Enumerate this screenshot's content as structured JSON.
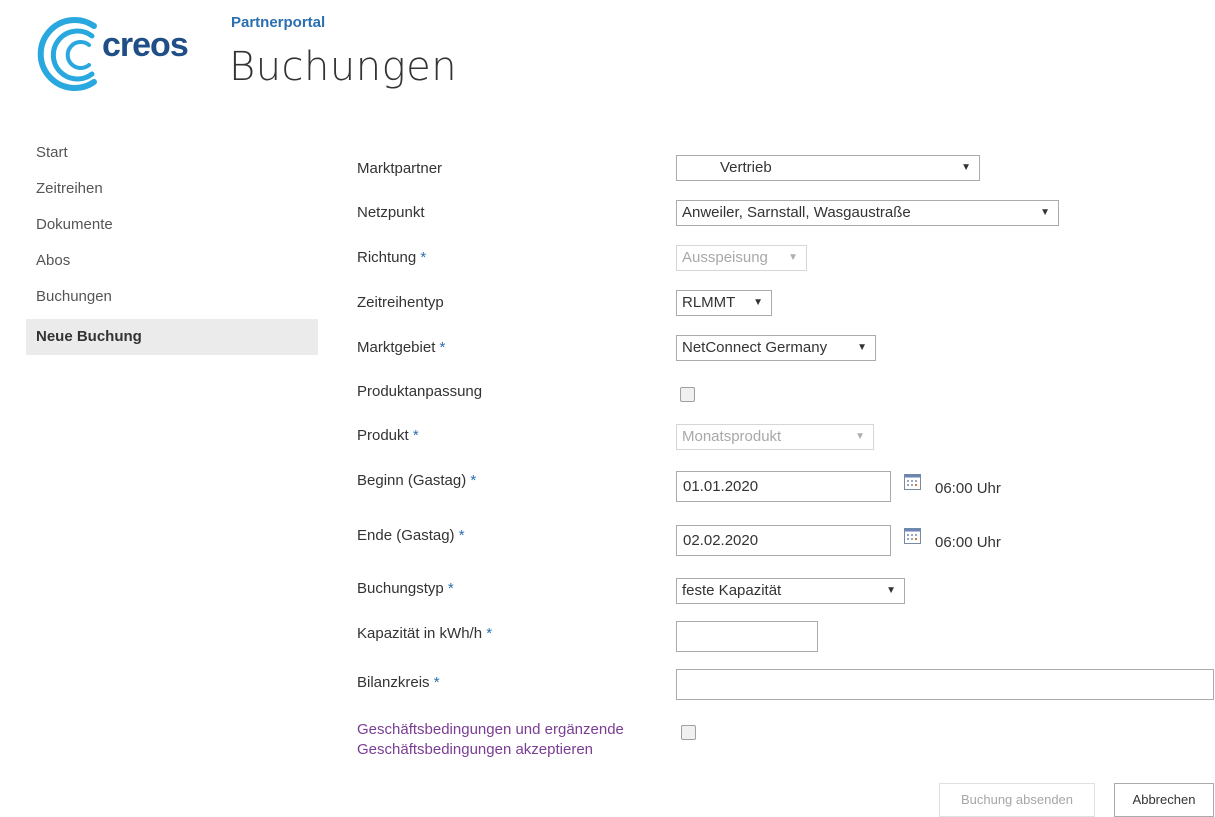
{
  "header": {
    "logo_text": "creos",
    "site_title": "Partnerportal",
    "page_title": "Buchungen"
  },
  "nav": {
    "items": [
      {
        "label": "Start",
        "active": false
      },
      {
        "label": "Zeitreihen",
        "active": false
      },
      {
        "label": "Dokumente",
        "active": false
      },
      {
        "label": "Abos",
        "active": false
      },
      {
        "label": "Buchungen",
        "active": false
      },
      {
        "label": "Neue Buchung",
        "active": true
      }
    ]
  },
  "form": {
    "required_marker": "*",
    "marktpartner": {
      "label": "Marktpartner",
      "value": "Vertrieb"
    },
    "netzpunkt": {
      "label": "Netzpunkt",
      "value": "Anweiler, Sarnstall, Wasgaustraße"
    },
    "richtung": {
      "label": "Richtung",
      "value": "Ausspeisung"
    },
    "zeitreihentyp": {
      "label": "Zeitreihentyp",
      "value": "RLMMT"
    },
    "marktgebiet": {
      "label": "Marktgebiet",
      "value": "NetConnect Germany"
    },
    "produktanpassung": {
      "label": "Produktanpassung",
      "checked": false
    },
    "produkt": {
      "label": "Produkt",
      "value": "Monatsprodukt"
    },
    "beginn": {
      "label": "Beginn (Gastag)",
      "value": "01.01.2020",
      "time": "06:00 Uhr"
    },
    "ende": {
      "label": "Ende (Gastag)",
      "value": "02.02.2020",
      "time": "06:00 Uhr"
    },
    "buchungstyp": {
      "label": "Buchungstyp",
      "value": "feste Kapazität"
    },
    "kapazitaet": {
      "label": "Kapazität in kWh/h",
      "value": ""
    },
    "bilanzkreis": {
      "label": "Bilanzkreis",
      "value": ""
    },
    "terms": {
      "line1": "Geschäftsbedingungen und ergänzende",
      "line2": "Geschäftsbedingungen akzeptieren",
      "checked": false
    }
  },
  "buttons": {
    "submit": "Buchung absenden",
    "cancel": "Abbrechen"
  },
  "colors": {
    "accent": "#2b6fb0",
    "link": "#7a3d94",
    "logo_ring": "#29a8e0"
  },
  "arrow_glyph": "▼"
}
